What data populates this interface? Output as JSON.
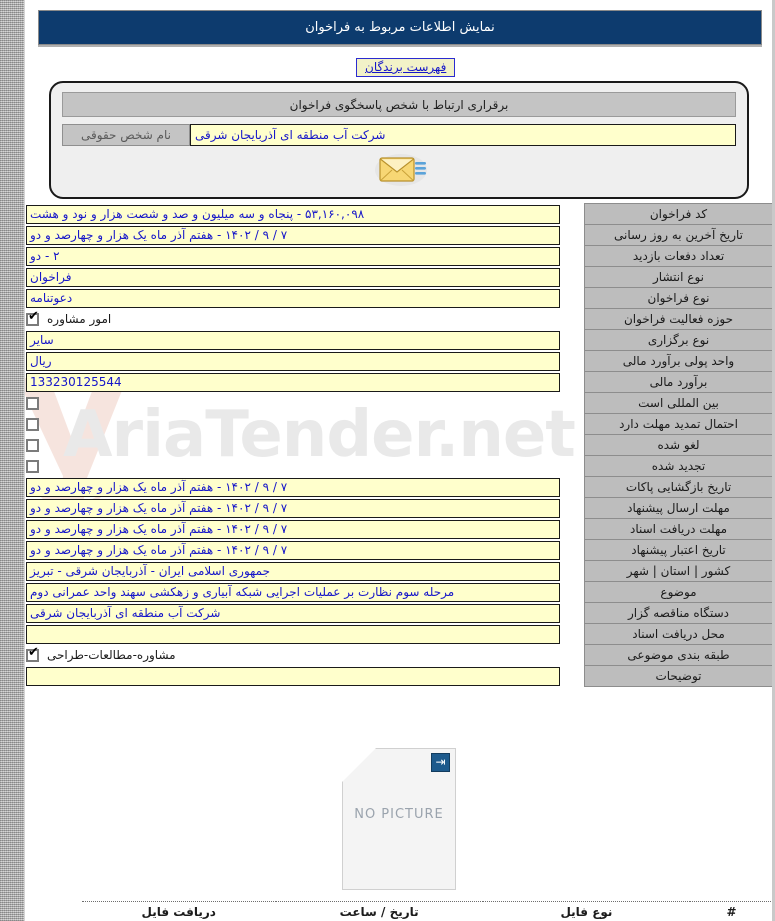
{
  "header": {
    "title": "نمایش اطلاعات مربوط به فراخوان"
  },
  "tabs": {
    "winners_label": "فهرست برندگان"
  },
  "contact_panel": {
    "header": "برقراری ارتباط با شخص پاسخگوی فراخوان",
    "legal_person_label": "نام شخص حقوقی",
    "legal_person_value": "شرکت آب منطقه ای آذربایجان شرقی",
    "mail_icon": "envelope-icon"
  },
  "info_rows": [
    {
      "label": "کد فراخوان",
      "value": "۵۳,۱۶۰,۰۹۸ - پنجاه و سه میلیون و صد و شصت هزار و نود و هشت",
      "type": "text"
    },
    {
      "label": "تاریخ آخرین به روز رسانی",
      "value": "۷ / ۹ / ۱۴۰۲ - هفتم آذر ماه یک هزار و چهارصد و دو",
      "type": "text"
    },
    {
      "label": "تعداد دفعات بازدید",
      "value": "۲ - دو",
      "type": "text"
    },
    {
      "label": "نوع انتشار",
      "value": "فراخوان",
      "type": "text"
    },
    {
      "label": "نوع فراخوان",
      "value": "دعوتنامه",
      "type": "text"
    },
    {
      "label": "حوزه فعالیت فراخوان",
      "value": "امور مشاوره",
      "type": "checkbox",
      "checked": true
    },
    {
      "label": "نوع برگزاری",
      "value": "سایر",
      "type": "text"
    },
    {
      "label": "واحد پولی برآورد مالی",
      "value": "ریال",
      "type": "text"
    },
    {
      "label": "برآورد مالی",
      "value": "133230125544",
      "type": "number"
    },
    {
      "label": "بین المللی است",
      "value": "",
      "type": "checkbox",
      "checked": false
    },
    {
      "label": "احتمال تمدید مهلت دارد",
      "value": "",
      "type": "checkbox",
      "checked": false
    },
    {
      "label": "لغو شده",
      "value": "",
      "type": "checkbox",
      "checked": false
    },
    {
      "label": "تجدید شده",
      "value": "",
      "type": "checkbox",
      "checked": false
    },
    {
      "label": "تاریخ بازگشایی پاکات",
      "value": "۷ / ۹ / ۱۴۰۲ - هفتم آذر ماه یک هزار و چهارصد و دو",
      "type": "text"
    },
    {
      "label": "مهلت ارسال پیشنهاد",
      "value": "۷ / ۹ / ۱۴۰۲ - هفتم آذر ماه یک هزار و چهارصد و دو",
      "type": "text"
    },
    {
      "label": "مهلت دریافت اسناد",
      "value": "۷ / ۹ / ۱۴۰۲ - هفتم آذر ماه یک هزار و چهارصد و دو",
      "type": "text"
    },
    {
      "label": "تاریخ اعتبار پیشنهاد",
      "value": "۷ / ۹ / ۱۴۰۲ - هفتم آذر ماه یک هزار و چهارصد و دو",
      "type": "text"
    },
    {
      "label": "کشور | استان | شهر",
      "value": "جمهوری اسلامی ایران - آذربایجان شرقی - تبریز",
      "type": "text"
    },
    {
      "label": "موضوع",
      "value": "مرحله سوم نظارت بر عملیات اجرایی شبکه آبیاری و زهکشی سهند واحد عمرانی دوم",
      "type": "text"
    },
    {
      "label": "دستگاه مناقصه گزار",
      "value": "شرکت آب منطقه ای آذربایجان شرقی",
      "type": "text"
    },
    {
      "label": "محل دریافت اسناد",
      "value": "",
      "type": "text"
    },
    {
      "label": "طبقه بندی موضوعی",
      "value": "مشاوره-مطالعات-طراحی",
      "type": "checkbox",
      "checked": true
    },
    {
      "label": "توضیحات",
      "value": "",
      "type": "text"
    }
  ],
  "picture": {
    "placeholder_text": "NO PICTURE",
    "broken_icon": "broken-image-icon"
  },
  "files_table": {
    "columns": [
      "#",
      "نوع فایل",
      "تاریخ / ساعت",
      "دریافت فایل"
    ]
  },
  "watermark": {
    "text": "AriaTender.net"
  },
  "colors": {
    "title_bar": "#0d3b6e",
    "label_cell": "#bdbdbd",
    "value_cell": "#ffffcc",
    "value_text": "#1616c9"
  }
}
